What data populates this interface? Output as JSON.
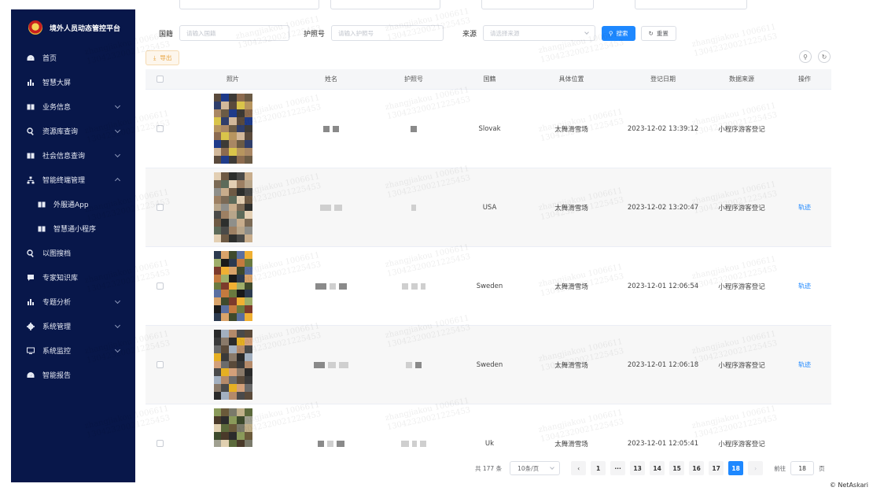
{
  "app": {
    "title": "境外人员动态管控平台"
  },
  "sidebar": {
    "items": [
      {
        "label": "首页",
        "icon": "dashboard-icon"
      },
      {
        "label": "智慧大屏",
        "icon": "bar-chart-icon"
      },
      {
        "label": "业务信息",
        "icon": "book-icon",
        "expandable": true
      },
      {
        "label": "资源库查询",
        "icon": "search-icon",
        "expandable": true
      },
      {
        "label": "社会信息查询",
        "icon": "book-icon",
        "expandable": true
      },
      {
        "label": "智能终端管理",
        "icon": "network-icon",
        "expandable": true,
        "expanded": true
      },
      {
        "label": "外服通App",
        "icon": "book-icon",
        "sub": true
      },
      {
        "label": "智慧通小程序",
        "icon": "book-icon",
        "sub": true
      },
      {
        "label": "以图搜档",
        "icon": "search-icon"
      },
      {
        "label": "专家知识库",
        "icon": "chat-icon"
      },
      {
        "label": "专题分析",
        "icon": "bar-chart-icon",
        "expandable": true
      },
      {
        "label": "系统管理",
        "icon": "gear-icon",
        "expandable": true
      },
      {
        "label": "系统监控",
        "icon": "monitor-icon",
        "expandable": true
      },
      {
        "label": "智能报告",
        "icon": "dashboard-icon"
      }
    ]
  },
  "filters": {
    "nationality_label": "国籍",
    "nationality_placeholder": "请输入国籍",
    "passport_label": "护照号",
    "passport_placeholder": "请输入护照号",
    "source_label": "来源",
    "source_placeholder": "请选择来源",
    "search_button": "搜索",
    "reset_button": "重置",
    "export_button": "导出"
  },
  "table": {
    "columns": [
      "照片",
      "姓名",
      "护照号",
      "国籍",
      "具体位置",
      "登记日期",
      "数据来源",
      "操作"
    ],
    "rows": [
      {
        "nationality": "Slovak",
        "location": "太舞滑雪场",
        "date": "2023-12-02 13:39:12",
        "source": "小程序游客登记",
        "action": ""
      },
      {
        "nationality": "USA",
        "location": "太舞滑雪场",
        "date": "2023-12-02 13:20:47",
        "source": "小程序游客登记",
        "action": "轨迹"
      },
      {
        "nationality": "Sweden",
        "location": "太舞滑雪场",
        "date": "2023-12-01 12:06:54",
        "source": "小程序游客登记",
        "action": "轨迹"
      },
      {
        "nationality": "Sweden",
        "location": "太舞滑雪场",
        "date": "2023-12-01 12:06:18",
        "source": "小程序游客登记",
        "action": "轨迹"
      },
      {
        "nationality": "Uk",
        "location": "太舞滑雪场",
        "date": "2023-12-01 12:05:41",
        "source": "小程序游客登记",
        "action": ""
      }
    ]
  },
  "watermark": {
    "line1": "zhangjiakou 1006611",
    "line2": "13042320021225453"
  },
  "pagination": {
    "total": "共 177 条",
    "page_size": "10条/页",
    "pages": [
      "1",
      "···",
      "13",
      "14",
      "15",
      "16",
      "17",
      "18"
    ],
    "active": "18",
    "goto_label": "前往",
    "goto_value": "18",
    "goto_suffix": "页"
  },
  "credit": "© NetAskari",
  "colors": {
    "sidebar": "#08174a",
    "primary": "#1e88ff",
    "export": "#e6a23c"
  }
}
